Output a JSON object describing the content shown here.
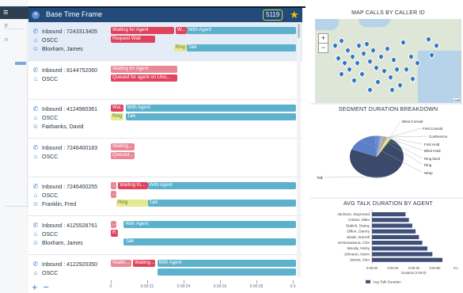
{
  "background_app": {
    "menu_glyph": "≡",
    "side_chars": [
      "F",
      "n"
    ]
  },
  "panel": {
    "title": "Base Time Frame",
    "count": "5119",
    "rows": [
      {
        "inbound": "Inbound : 7243313405",
        "queue": "OSCC",
        "agent": "Bloxham, James",
        "selected": true,
        "segments": [
          {
            "label": "Waiting for Agent",
            "color": "red",
            "line": 0,
            "start": 0,
            "width": 34
          },
          {
            "label": "W...",
            "color": "red",
            "line": 0,
            "start": 35,
            "width": 6
          },
          {
            "label": "With Agent",
            "color": "teal",
            "line": 0,
            "start": 41,
            "width": 59
          },
          {
            "label": "Request Wait",
            "color": "red",
            "line": 1,
            "start": 0,
            "width": 24
          },
          {
            "label": "Ring",
            "color": "yellow",
            "line": 2,
            "start": 34,
            "width": 7
          },
          {
            "label": "Talk",
            "color": "teal",
            "line": 2,
            "start": 41,
            "width": 59
          }
        ]
      },
      {
        "inbound": "Inbound : 8144752060",
        "queue": "OSCC",
        "agent": "",
        "selected": false,
        "segments": [
          {
            "label": "Waiting for Agent",
            "color": "pink",
            "line": 0,
            "start": 0,
            "width": 36
          },
          {
            "label": "Queued for agent on Unic...",
            "color": "red",
            "line": 1,
            "start": 0,
            "width": 36
          }
        ]
      },
      {
        "inbound": "Inbound : 4124960361",
        "queue": "OSCC",
        "agent": "Fairbanks, David",
        "selected": false,
        "segments": [
          {
            "label": "Wai...",
            "color": "red",
            "line": 0,
            "start": 0,
            "width": 7
          },
          {
            "label": "With Agent",
            "color": "teal",
            "line": 0,
            "start": 8,
            "width": 92
          },
          {
            "label": "Ring",
            "color": "yellow",
            "line": 1,
            "start": 0,
            "width": 7
          },
          {
            "label": "Talk",
            "color": "teal",
            "line": 1,
            "start": 8,
            "width": 92
          }
        ]
      },
      {
        "inbound": "Inbound : 7246400183",
        "queue": "OSCC",
        "agent": "",
        "selected": false,
        "segments": [
          {
            "label": "Waiting...",
            "color": "pink",
            "line": 0,
            "start": 0,
            "width": 13
          },
          {
            "label": "Queued...",
            "color": "pink",
            "line": 1,
            "start": 0,
            "width": 13
          }
        ]
      },
      {
        "inbound": "Inbound : 7246400255",
        "queue": "OSCC",
        "agent": "Franklin, Fred",
        "selected": false,
        "segments": [
          {
            "label": "...",
            "color": "pink",
            "line": 0,
            "start": 0,
            "width": 3
          },
          {
            "label": "Waiting fo...",
            "color": "red",
            "line": 0,
            "start": 4,
            "width": 16
          },
          {
            "label": "With Agent",
            "color": "teal",
            "line": 0,
            "start": 20,
            "width": 80
          },
          {
            "label": "...",
            "color": "pink",
            "line": 1,
            "start": 0,
            "width": 3
          },
          {
            "label": "Ring",
            "color": "yellow",
            "line": 2,
            "start": 3,
            "width": 17
          },
          {
            "label": "Talk",
            "color": "teal",
            "line": 2,
            "start": 20,
            "width": 80
          }
        ]
      },
      {
        "inbound": "Inbound : 4125528761",
        "queue": "OSCC",
        "agent": "Bloxham, James",
        "selected": false,
        "segments": [
          {
            "label": "...",
            "color": "pink",
            "line": 0,
            "start": 0,
            "width": 3
          },
          {
            "label": "With Agent",
            "color": "teal",
            "line": 0,
            "start": 7,
            "width": 93
          },
          {
            "label": "R...",
            "color": "red",
            "line": 1,
            "start": 0,
            "width": 4
          },
          {
            "label": "Talk",
            "color": "teal",
            "line": 2,
            "start": 7,
            "width": 93
          }
        ]
      },
      {
        "inbound": "Inbound : 4122920350",
        "queue": "OSCC",
        "agent": "",
        "selected": false,
        "segments": [
          {
            "label": "Waitin...",
            "color": "pink",
            "line": 0,
            "start": 0,
            "width": 11
          },
          {
            "label": "Waiting...",
            "color": "red",
            "line": 0,
            "start": 12,
            "width": 12
          },
          {
            "label": "With Agent",
            "color": "teal",
            "line": 0,
            "start": 25,
            "width": 75
          },
          {
            "label": "",
            "color": "teal",
            "line": 1,
            "start": 25,
            "width": 75
          }
        ]
      }
    ],
    "axis_ticks": [
      "0",
      "0:00:22",
      "0:00:24",
      "0:00:26",
      "0:00:28",
      "0:0"
    ]
  },
  "map_widget": {
    "title": "MAP CALLS BY CALLER ID",
    "zoom_in": "+",
    "zoom_out": "−",
    "credit": "Leafl"
  },
  "segment_widget": {
    "title": "SEGMENT DURATION BREAKDOWN",
    "chart_data": {
      "type": "pie",
      "slices": [
        {
          "name": "Talk",
          "value": 72,
          "color": "#3b4a6b"
        },
        {
          "name": "Wrap",
          "value": 18,
          "color": "#5b7fc9"
        },
        {
          "name": "Ring",
          "value": 3,
          "color": "#6f88c9"
        },
        {
          "name": "Ring back",
          "value": 1.5,
          "color": "#8ea3d6"
        },
        {
          "name": "Blind Hold",
          "value": 1,
          "color": "#a5b6e0"
        },
        {
          "name": "First Hold",
          "value": 1,
          "color": "#c7a23f"
        },
        {
          "name": "Conference",
          "value": 1,
          "color": "#9aa2b2"
        },
        {
          "name": "First Consult",
          "value": 1,
          "color": "#d7dbe2"
        },
        {
          "name": "Blind Consult",
          "value": 1.5,
          "color": "#e5e15b"
        }
      ]
    }
  },
  "talk_widget": {
    "title": "AVG TALK DURATION BY AGENT",
    "legend": "Avg Talk Duration",
    "chart_data": {
      "type": "bar",
      "categories": [
        "Jackson, Daymond",
        "Cotton, Mike",
        "Stalick, Dassy",
        "Dillon, Danny",
        "Slade, Darrell",
        "Schimassena, Che",
        "Moody, Nicky",
        "Johnson, Norm",
        "James, Deo"
      ],
      "values": [
        0.2,
        0.22,
        0.24,
        0.26,
        0.28,
        0.3,
        0.33,
        0.36,
        0.42
      ],
      "xlabel": "Duration (H:M:S)",
      "xticks": [
        "0:00:00",
        "0:00:20",
        "0:00:40",
        "0:00:60",
        "0:1"
      ]
    }
  }
}
